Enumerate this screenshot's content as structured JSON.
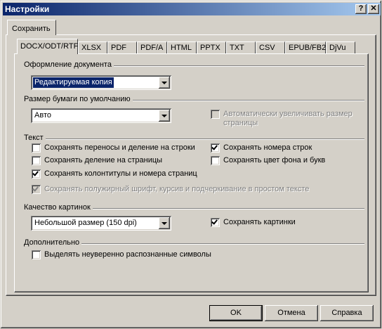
{
  "window": {
    "title": "Настройки",
    "help_glyph": "?",
    "close_glyph": "✕"
  },
  "outer_tab": {
    "label": "Сохранить"
  },
  "tabs": [
    {
      "label": "DOCX/ODT/RTF",
      "active": true
    },
    {
      "label": "XLSX"
    },
    {
      "label": "PDF"
    },
    {
      "label": "PDF/A"
    },
    {
      "label": "HTML"
    },
    {
      "label": "PPTX"
    },
    {
      "label": "TXT"
    },
    {
      "label": "CSV"
    },
    {
      "label": "EPUB/FB2"
    },
    {
      "label": "DjVu"
    }
  ],
  "layout_group": {
    "label": "Оформление документа",
    "select_value": "Редактируемая копия"
  },
  "paper_group": {
    "label": "Размер бумаги по умолчанию",
    "select_value": "Авто",
    "auto_enlarge": {
      "label_line1": "Автоматически увеличивать размер",
      "label_line2": "страницы",
      "checked": false,
      "enabled": false
    }
  },
  "text_group": {
    "label": "Текст",
    "options": [
      {
        "label": "Сохранять переносы и деление на строки",
        "checked": false,
        "enabled": true
      },
      {
        "label": "Сохранять номера строк",
        "checked": true,
        "enabled": true
      },
      {
        "label": "Сохранять деление на страницы",
        "checked": false,
        "enabled": true
      },
      {
        "label": "Сохранять цвет фона и букв",
        "checked": false,
        "enabled": true
      },
      {
        "label": "Сохранять колонтитулы и номера страниц",
        "checked": true,
        "enabled": true
      },
      {
        "label": "Сохранять полужирный шрифт, курсив и подчеркивание в простом тексте",
        "checked": true,
        "enabled": false
      }
    ]
  },
  "image_group": {
    "label": "Качество картинок",
    "select_value": "Небольшой размер (150 dpi)",
    "save_images": {
      "label": "Сохранять картинки",
      "checked": true
    }
  },
  "extra_group": {
    "label": "Дополнительно",
    "highlight": {
      "label": "Выделять неуверенно распознанные символы",
      "checked": false
    }
  },
  "buttons": {
    "ok": "OK",
    "cancel": "Отмена",
    "help": "Справка"
  }
}
